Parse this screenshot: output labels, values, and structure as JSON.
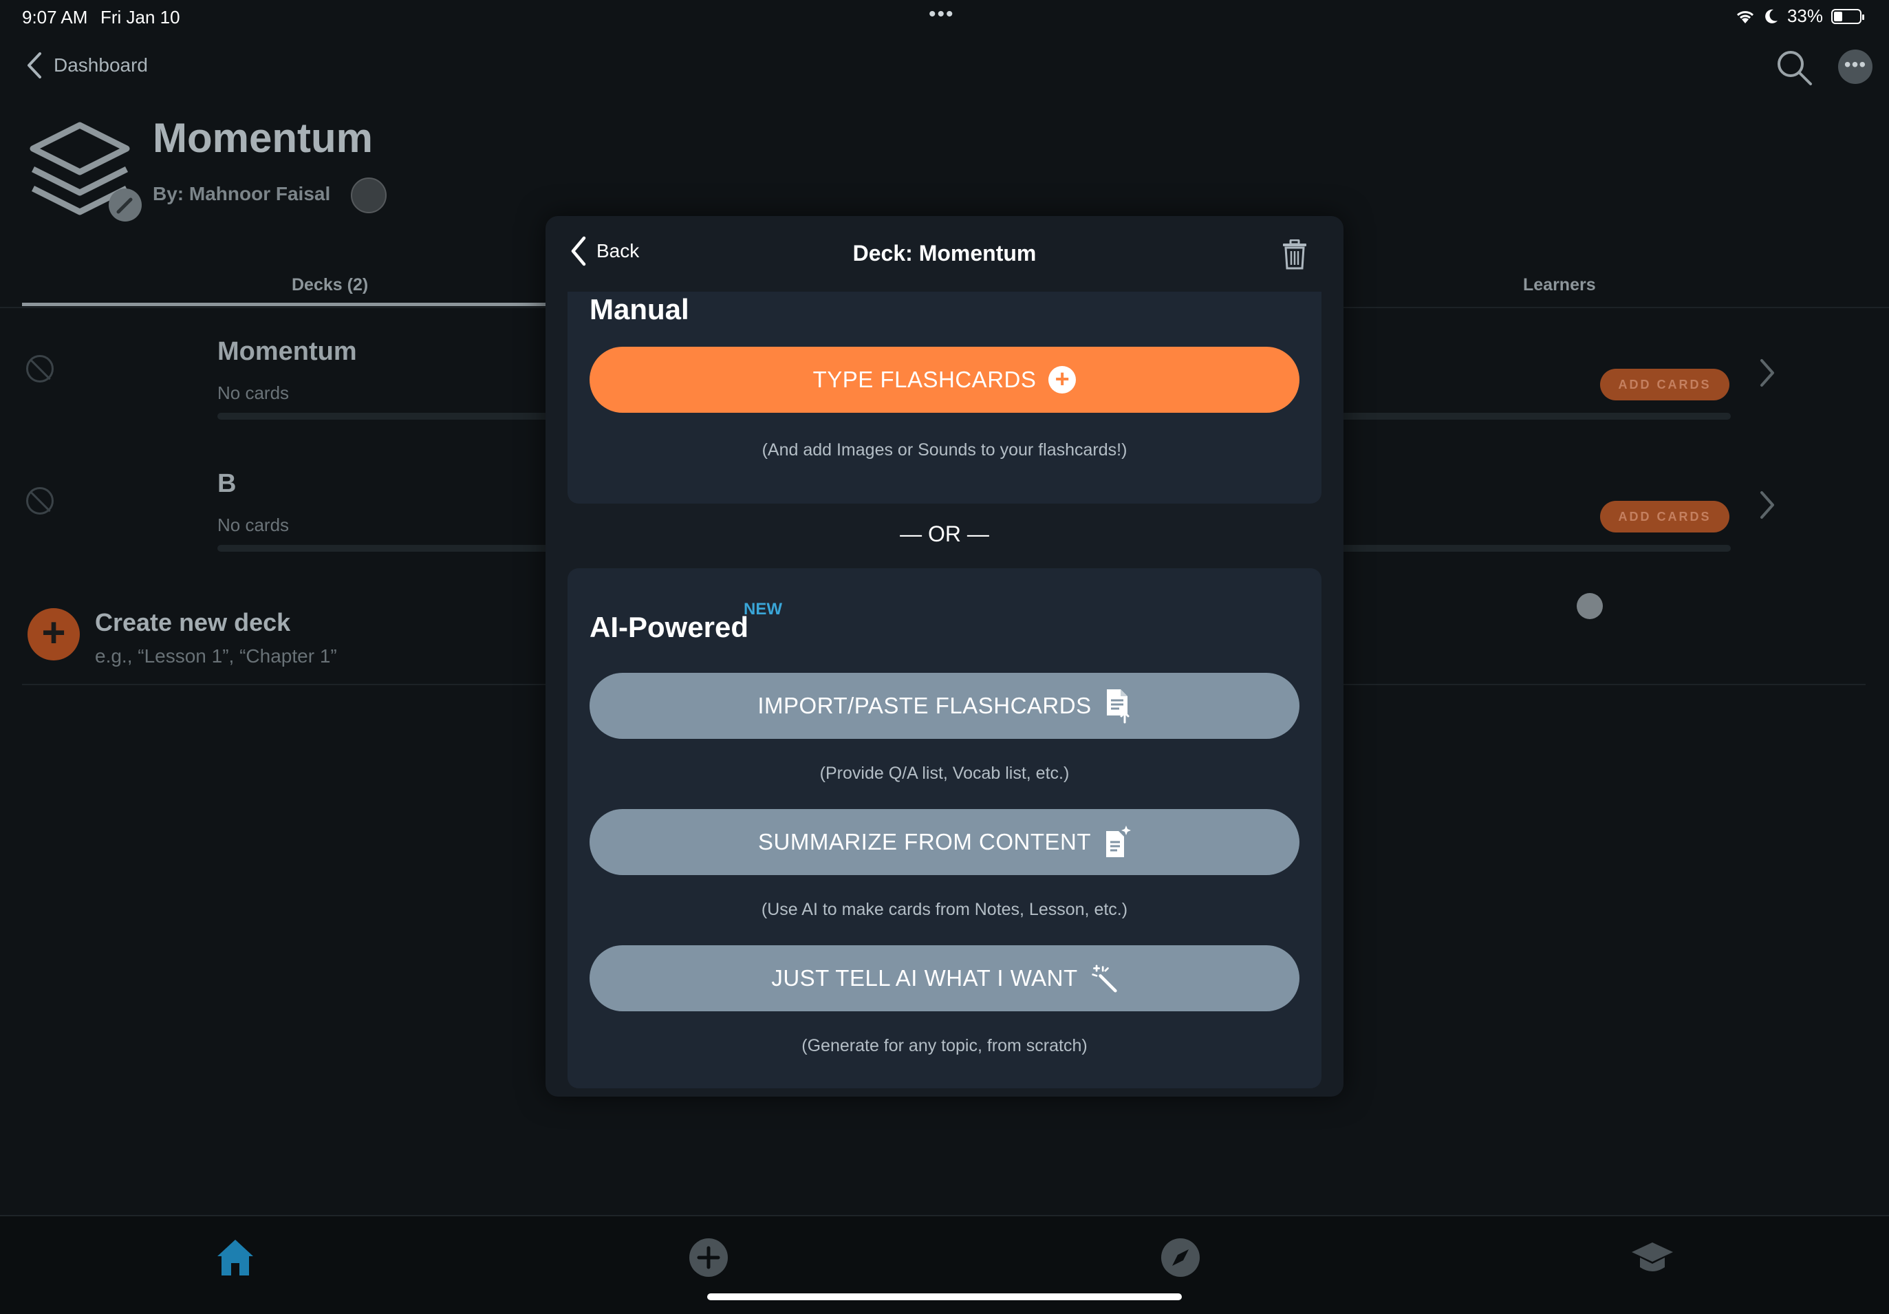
{
  "status_bar": {
    "time": "9:07 AM",
    "date": "Fri Jan 10",
    "battery_percent": "33%",
    "battery_level": 0.33
  },
  "nav": {
    "back_label": "Dashboard",
    "icons": [
      "search-icon",
      "more-icon"
    ]
  },
  "group": {
    "title": "Momentum",
    "author": "By: Mahnoor Faisal"
  },
  "tabs": [
    {
      "label": "Decks (2)",
      "active": true
    },
    {
      "label": "Learners",
      "active": false
    }
  ],
  "decks": [
    {
      "name": "Momentum",
      "subtitle": "No cards",
      "add_label": "ADD CARDS"
    },
    {
      "name": "B",
      "subtitle": "No cards",
      "add_label": "ADD CARDS"
    }
  ],
  "create_deck": {
    "title": "Create new deck",
    "hint": "e.g., “Lesson 1”, “Chapter 1”"
  },
  "bottom_nav": [
    "home-icon",
    "add-icon",
    "explore-compass-icon",
    "learn-graduation-cap-icon"
  ],
  "modal": {
    "back_label": "Back",
    "title": "Deck: Momentum",
    "manual": {
      "title": "Manual",
      "button_label": "TYPE FLASHCARDS",
      "caption": "(And add Images or Sounds to your flashcards!)"
    },
    "or_label": "— OR —",
    "ai": {
      "title": "AI-Powered",
      "new_tag": "NEW",
      "buttons": [
        {
          "label": "IMPORT/PASTE FLASHCARDS",
          "caption": "(Provide Q/A list, Vocab list, etc.)",
          "icon": "document-upload-icon"
        },
        {
          "label": "SUMMARIZE FROM CONTENT",
          "caption": "(Use AI to make cards from Notes, Lesson, etc.)",
          "icon": "document-sparkle-icon"
        },
        {
          "label": "JUST TELL AI WHAT I WANT",
          "caption": "(Generate for any topic, from scratch)",
          "icon": "magic-wand-icon"
        }
      ]
    }
  },
  "colors": {
    "accent_orange": "#ff8540",
    "ai_button": "#8194a4",
    "new_tag": "#3aa6d8",
    "modal_bg": "#171d24",
    "card_bg": "#1e2733"
  }
}
